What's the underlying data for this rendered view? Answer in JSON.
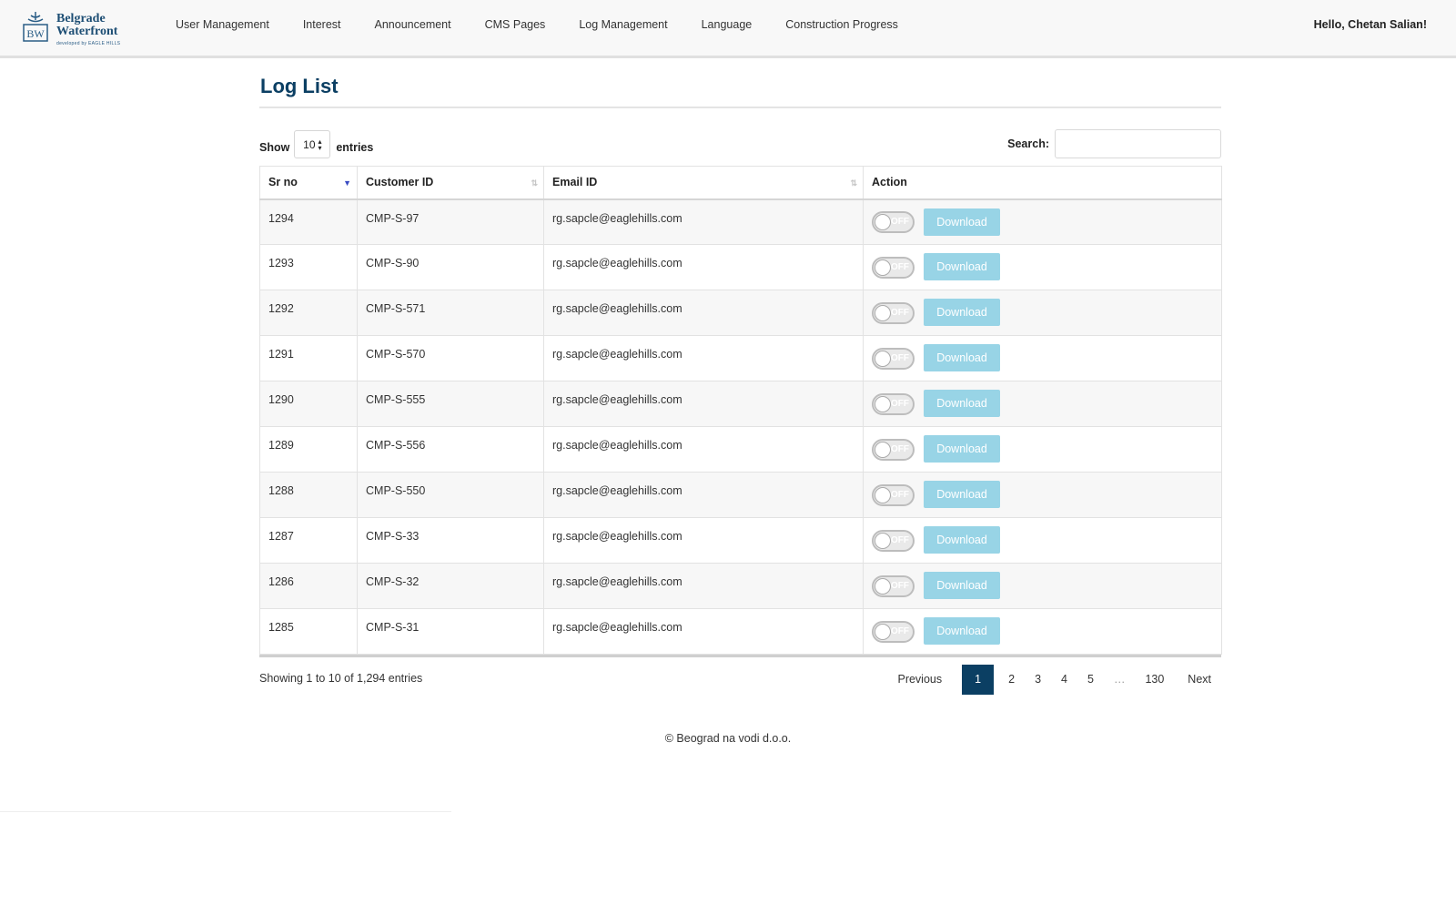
{
  "brand": {
    "line1": "Belgrade",
    "line2": "Waterfront",
    "tagline": "developed by EAGLE HILLS",
    "emblem_letters": "BW"
  },
  "nav": [
    {
      "label": "User Management"
    },
    {
      "label": "Interest"
    },
    {
      "label": "Announcement"
    },
    {
      "label": "CMS Pages"
    },
    {
      "label": "Log Management"
    },
    {
      "label": "Language"
    },
    {
      "label": "Construction Progress"
    }
  ],
  "greeting": "Hello, Chetan Salian!",
  "page_title": "Log List",
  "controls": {
    "show_label": "Show",
    "entries_value": "10",
    "entries_label": "entries",
    "search_label": "Search:",
    "search_value": ""
  },
  "table": {
    "columns": [
      "Sr no",
      "Customer ID",
      "Email ID",
      "Action"
    ],
    "toggle_label": "OFF",
    "download_label": "Download",
    "rows": [
      {
        "sr": "1294",
        "customer_id": "CMP-S-97",
        "email": "rg.sapcle@eaglehills.com"
      },
      {
        "sr": "1293",
        "customer_id": "CMP-S-90",
        "email": "rg.sapcle@eaglehills.com"
      },
      {
        "sr": "1292",
        "customer_id": "CMP-S-571",
        "email": "rg.sapcle@eaglehills.com"
      },
      {
        "sr": "1291",
        "customer_id": "CMP-S-570",
        "email": "rg.sapcle@eaglehills.com"
      },
      {
        "sr": "1290",
        "customer_id": "CMP-S-555",
        "email": "rg.sapcle@eaglehills.com"
      },
      {
        "sr": "1289",
        "customer_id": "CMP-S-556",
        "email": "rg.sapcle@eaglehills.com"
      },
      {
        "sr": "1288",
        "customer_id": "CMP-S-550",
        "email": "rg.sapcle@eaglehills.com"
      },
      {
        "sr": "1287",
        "customer_id": "CMP-S-33",
        "email": "rg.sapcle@eaglehills.com"
      },
      {
        "sr": "1286",
        "customer_id": "CMP-S-32",
        "email": "rg.sapcle@eaglehills.com"
      },
      {
        "sr": "1285",
        "customer_id": "CMP-S-31",
        "email": "rg.sapcle@eaglehills.com"
      }
    ]
  },
  "info": "Showing 1 to 10 of 1,294 entries",
  "pagination": {
    "previous": "Previous",
    "pages": [
      "1",
      "2",
      "3",
      "4",
      "5",
      "…",
      "130"
    ],
    "active": "1",
    "next": "Next"
  },
  "footer": "© Beograd na vodi d.o.o.",
  "colors": {
    "primary": "#0b3f63",
    "download_button": "#98d4e6",
    "navbar_bg": "#f8f8f8"
  }
}
